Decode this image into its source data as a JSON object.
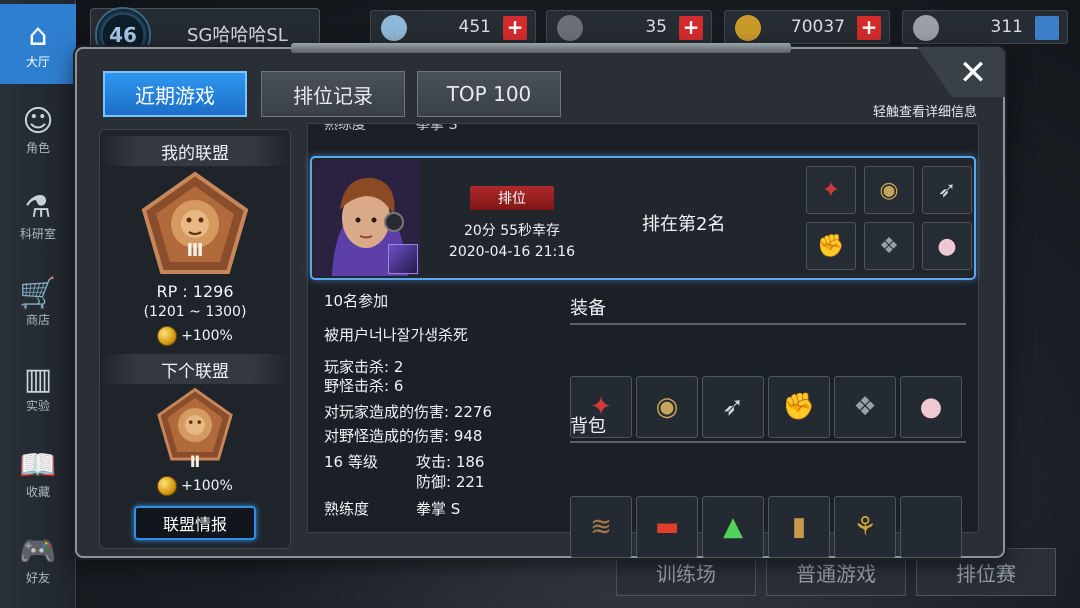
{
  "background": {
    "nav": [
      {
        "label": "大厅",
        "icon": "home-icon",
        "glyph": "⌂",
        "active": true
      },
      {
        "label": "角色",
        "icon": "character-icon",
        "glyph": "☺"
      },
      {
        "label": "科研室",
        "icon": "flask-icon",
        "glyph": "⚗"
      },
      {
        "label": "商店",
        "icon": "cart-icon",
        "glyph": "🛒"
      },
      {
        "label": "实验",
        "icon": "books-icon",
        "glyph": "▥"
      },
      {
        "label": "收藏",
        "icon": "book-icon",
        "glyph": "📖"
      },
      {
        "label": "好友",
        "icon": "gamepad-icon",
        "glyph": "🎮"
      }
    ],
    "player": {
      "level": "46",
      "name": "SG哈哈哈SL"
    },
    "currencies": [
      {
        "icon": "gem-icon",
        "value": "451",
        "color": "#8fb7d6"
      },
      {
        "icon": "ticket-icon",
        "value": "35",
        "color": "#6b7078"
      },
      {
        "icon": "coin-icon",
        "value": "70037",
        "color": "#c99a2a"
      },
      {
        "icon": "bp-icon",
        "value": "311",
        "color": "#9aa0a6"
      }
    ],
    "bottom_buttons": [
      "训练场",
      "普通游戏",
      "排位赛"
    ]
  },
  "modal": {
    "tabs": [
      "近期游戏",
      "排位记录",
      "TOP 100"
    ],
    "active_tab": 0,
    "hint": "轻触查看详细信息",
    "close_label": "✕",
    "alliance": {
      "my_title": "我的联盟",
      "my_tier": "Ⅲ",
      "rp": "RP : 1296",
      "range": "(1201 ~ 1300)",
      "my_bonus": "+100%",
      "next_title": "下个联盟",
      "next_tier": "Ⅱ",
      "next_bonus": "+100%",
      "info_button": "联盟情报"
    },
    "peek_row": {
      "label": "熟练度",
      "value": "拳掌 S"
    },
    "match": {
      "mode": "排位",
      "survive": "20分 55秒幸存",
      "datetime": "2020-04-16 21:16",
      "rank": "排在第2名",
      "mini_items": [
        "red-weapon-icon",
        "gauntlet-icon",
        "blade-icon",
        "red-arm-icon",
        "black-armor-icon",
        "pearl-icon"
      ]
    },
    "details": {
      "participants": "10名参加",
      "killed_by": "被用户너나잘가생杀死",
      "player_kills": "玩家击杀: 2",
      "monster_kills": "野怪击杀: 6",
      "player_damage": "对玩家造成的伤害: 2276",
      "monster_damage": "对野怪造成的伤害: 948",
      "level": "16 等级",
      "attack": "攻击: 186",
      "defense": "防御: 221",
      "mastery_label": "熟练度",
      "mastery_value": "拳掌 S"
    },
    "equipment": {
      "title": "装备",
      "items": [
        "red-weapon-icon",
        "gauntlet-icon",
        "blade-icon",
        "red-arm-icon",
        "black-armor-icon",
        "pearl-icon"
      ]
    },
    "backpack": {
      "title": "背包",
      "items": [
        "branch-bundle-icon",
        "red-bar-icon",
        "green-powder-icon",
        "jar-icon",
        "root-icon",
        "empty-slot"
      ]
    }
  }
}
